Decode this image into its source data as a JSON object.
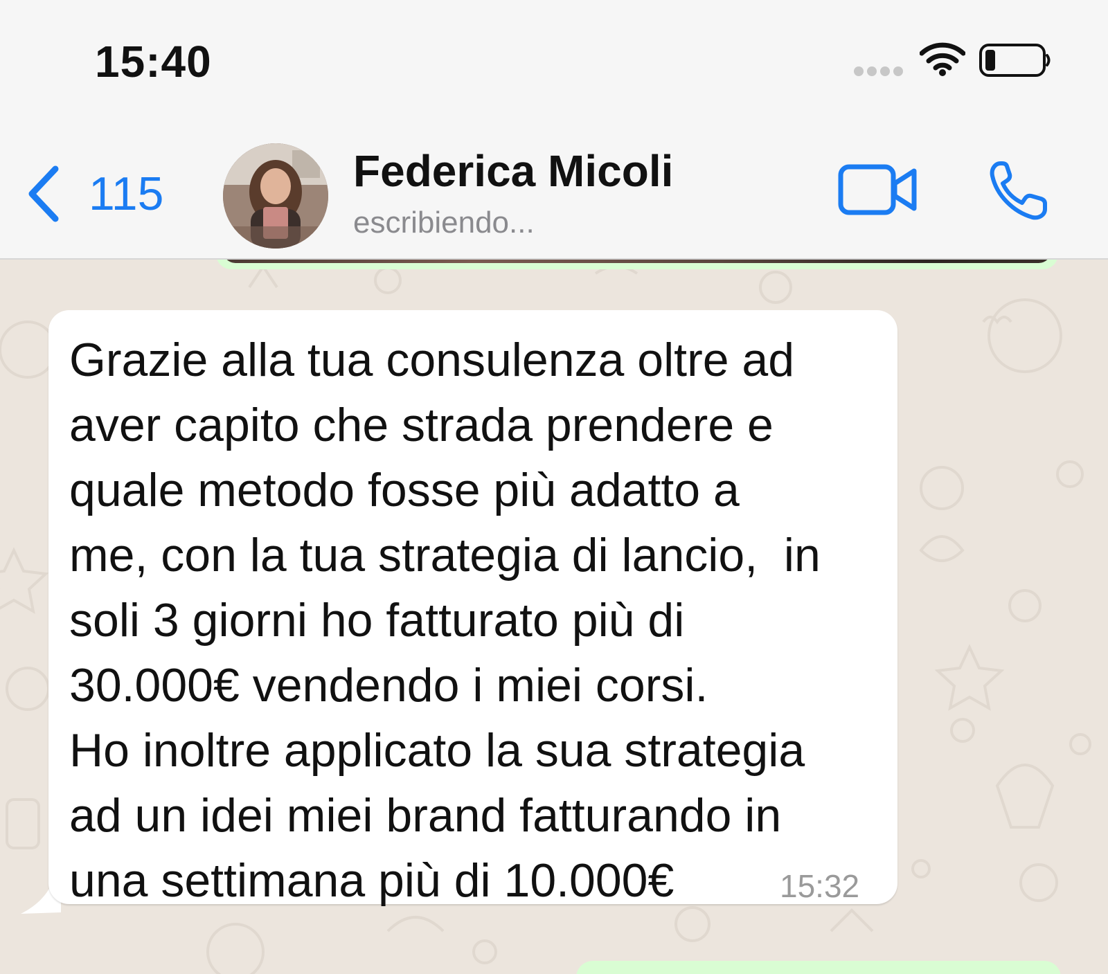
{
  "status_bar": {
    "time": "15:40",
    "icons": [
      "signal-dots-icon",
      "wifi-icon",
      "battery-icon"
    ]
  },
  "header": {
    "back_count": "115",
    "contact_name": "Federica Micoli",
    "contact_status": "escribiendo...",
    "icons": [
      "chevron-left-icon",
      "video-camera-icon",
      "phone-icon"
    ]
  },
  "message": {
    "lines": [
      "Grazie alla tua consulenza oltre ad",
      "aver capito che strada prendere e",
      "quale metodo fosse più adatto a",
      "me, con la tua strategia di lancio,  in",
      "soli 3 giorni ho fatturato più di",
      "30.000€ vendendo i miei corsi.",
      "Ho inoltre applicato la sua strategia",
      "ad un idei miei brand fatturando in",
      "una settimana più di 10.000€"
    ],
    "time": "15:32"
  },
  "colors": {
    "accent": "#1b7cf2",
    "header_bg": "#f6f6f6",
    "chat_bg": "#ece5dd",
    "incoming_bubble": "#ffffff",
    "outgoing_bubble": "#d9fdd3",
    "secondary_text": "#8a8a8e"
  }
}
